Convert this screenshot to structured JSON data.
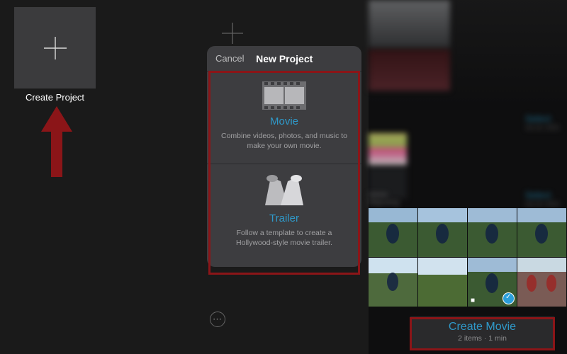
{
  "panel1": {
    "create_label": "Create Project"
  },
  "panel2": {
    "cancel": "Cancel",
    "title": "New Project",
    "movie": {
      "title": "Movie",
      "desc": "Combine videos, photos, and music to make your own movie."
    },
    "trailer": {
      "title": "Trailer",
      "desc": "Follow a template to create a Hollywood-style movie trailer."
    },
    "more_glyph": "⋯"
  },
  "panel3": {
    "select_label": "Select",
    "select_date": "Jul 10, 2021",
    "album_name": "Home",
    "album_sub": "Mapusing",
    "create_movie": "Create Movie",
    "create_movie_sub": "2 items · 1 min"
  }
}
